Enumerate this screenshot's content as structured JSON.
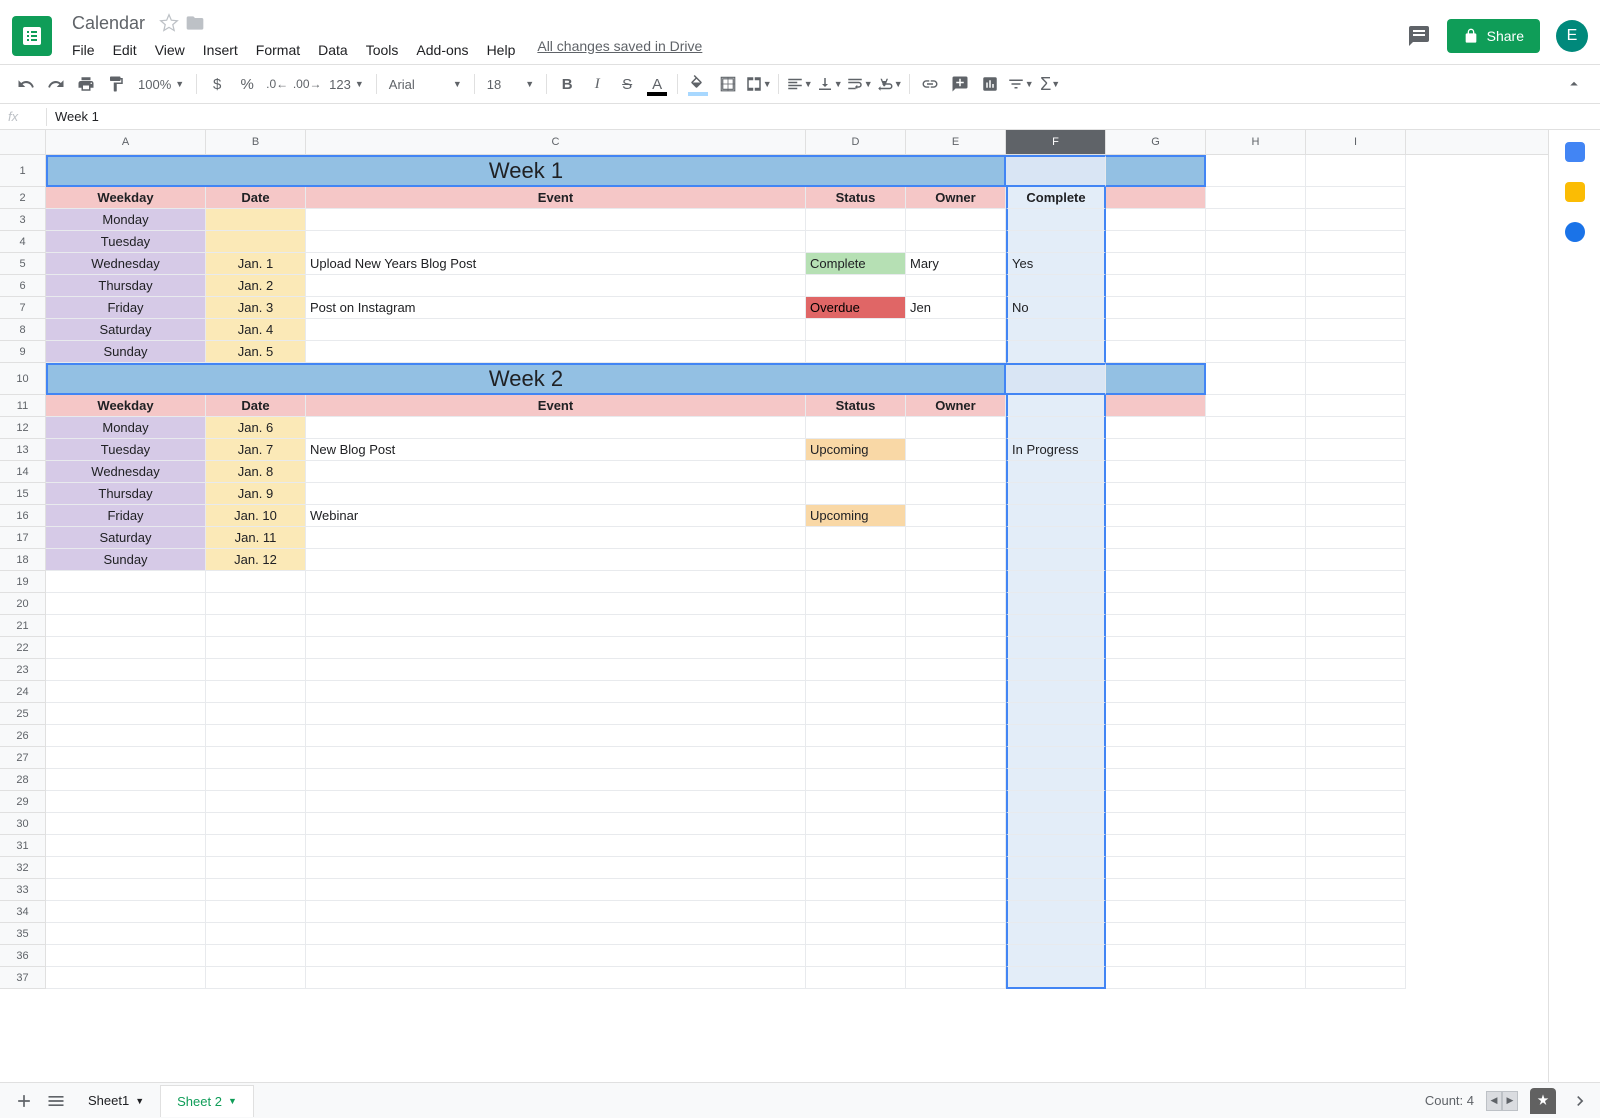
{
  "doc_title": "Calendar",
  "menu": [
    "File",
    "Edit",
    "View",
    "Insert",
    "Format",
    "Data",
    "Tools",
    "Add-ons",
    "Help"
  ],
  "save_status": "All changes saved in Drive",
  "share_label": "Share",
  "avatar_initial": "E",
  "toolbar": {
    "zoom": "100%",
    "font": "Arial",
    "font_size": "18",
    "number_format": "123"
  },
  "formula_value": "Week 1",
  "columns": [
    "A",
    "B",
    "C",
    "D",
    "E",
    "F",
    "G",
    "H",
    "I"
  ],
  "selected_column": "F",
  "row_count": 37,
  "headers": {
    "weekday": "Weekday",
    "date": "Date",
    "event": "Event",
    "status": "Status",
    "owner": "Owner",
    "complete": "Complete"
  },
  "weeks": [
    {
      "title": "Week 1",
      "row_num": 1,
      "header_row": 2,
      "days": [
        {
          "row": 3,
          "weekday": "Monday",
          "date": "",
          "event": "",
          "status": "",
          "status_bg": "",
          "owner": "",
          "complete": ""
        },
        {
          "row": 4,
          "weekday": "Tuesday",
          "date": "",
          "event": "",
          "status": "",
          "status_bg": "",
          "owner": "",
          "complete": ""
        },
        {
          "row": 5,
          "weekday": "Wednesday",
          "date": "Jan. 1",
          "event": "Upload New Years Blog Post",
          "status": "Complete",
          "status_bg": "bg-green",
          "owner": "Mary",
          "complete": "Yes"
        },
        {
          "row": 6,
          "weekday": "Thursday",
          "date": "Jan. 2",
          "event": "",
          "status": "",
          "status_bg": "",
          "owner": "",
          "complete": ""
        },
        {
          "row": 7,
          "weekday": "Friday",
          "date": "Jan. 3",
          "event": "Post on Instagram",
          "status": "Overdue",
          "status_bg": "bg-red",
          "owner": "Jen",
          "complete": "No"
        },
        {
          "row": 8,
          "weekday": "Saturday",
          "date": "Jan. 4",
          "event": "",
          "status": "",
          "status_bg": "",
          "owner": "",
          "complete": ""
        },
        {
          "row": 9,
          "weekday": "Sunday",
          "date": "Jan. 5",
          "event": "",
          "status": "",
          "status_bg": "",
          "owner": "",
          "complete": ""
        }
      ]
    },
    {
      "title": "Week 2",
      "row_num": 10,
      "header_row": 11,
      "show_complete_header": false,
      "days": [
        {
          "row": 12,
          "weekday": "Monday",
          "date": "Jan. 6",
          "event": "",
          "status": "",
          "status_bg": "",
          "owner": "",
          "complete": ""
        },
        {
          "row": 13,
          "weekday": "Tuesday",
          "date": "Jan. 7",
          "event": "New Blog Post",
          "status": "Upcoming",
          "status_bg": "bg-orange",
          "owner": "",
          "complete": "In Progress"
        },
        {
          "row": 14,
          "weekday": "Wednesday",
          "date": "Jan. 8",
          "event": "",
          "status": "",
          "status_bg": "",
          "owner": "",
          "complete": ""
        },
        {
          "row": 15,
          "weekday": "Thursday",
          "date": "Jan. 9",
          "event": "",
          "status": "",
          "status_bg": "",
          "owner": "",
          "complete": ""
        },
        {
          "row": 16,
          "weekday": "Friday",
          "date": "Jan. 10",
          "event": "Webinar",
          "status": "Upcoming",
          "status_bg": "bg-orange",
          "owner": "",
          "complete": ""
        },
        {
          "row": 17,
          "weekday": "Saturday",
          "date": "Jan. 11",
          "event": "",
          "status": "",
          "status_bg": "",
          "owner": "",
          "complete": ""
        },
        {
          "row": 18,
          "weekday": "Sunday",
          "date": "Jan. 12",
          "event": "",
          "status": "",
          "status_bg": "",
          "owner": "",
          "complete": ""
        }
      ]
    }
  ],
  "sheet_tabs": [
    {
      "name": "Sheet1",
      "active": false
    },
    {
      "name": "Sheet 2",
      "active": true
    }
  ],
  "status_bar": {
    "count_label": "Count: 4"
  }
}
